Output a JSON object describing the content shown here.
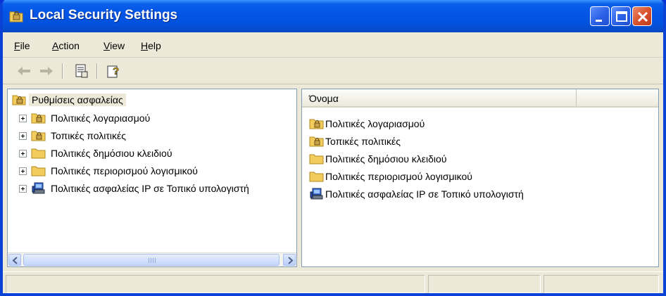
{
  "window": {
    "title": "Local Security Settings"
  },
  "menu": {
    "file": {
      "accel": "F",
      "rest": "ile"
    },
    "action": {
      "accel": "A",
      "rest": "ction"
    },
    "view": {
      "accel": "V",
      "rest": "iew"
    },
    "help": {
      "accel": "H",
      "rest": "elp"
    }
  },
  "tree": {
    "root": "Ρυθμίσεις ασφαλείας",
    "items": [
      {
        "label": "Πολιτικές λογαριασμού",
        "icon": "folder-lock-icon"
      },
      {
        "label": "Τοπικές πολιτικές",
        "icon": "folder-lock-icon"
      },
      {
        "label": "Πολιτικές δημόσιου κλειδιού",
        "icon": "folder-icon"
      },
      {
        "label": "Πολιτικές περιορισμού λογισμικού",
        "icon": "folder-icon"
      },
      {
        "label": "Πολιτικές ασφαλείας IP σε Τοπικό υπολογιστή",
        "icon": "ip-security-icon"
      }
    ]
  },
  "list": {
    "column_name": "Όνομα",
    "items": [
      {
        "label": "Πολιτικές λογαριασμού",
        "icon": "folder-lock-icon"
      },
      {
        "label": "Τοπικές πολιτικές",
        "icon": "folder-lock-icon"
      },
      {
        "label": "Πολιτικές δημόσιου κλειδιού",
        "icon": "folder-icon"
      },
      {
        "label": "Πολιτικές περιορισμού λογισμικού",
        "icon": "folder-icon"
      },
      {
        "label": "Πολιτικές ασφαλείας IP σε Τοπικό υπολογιστή",
        "icon": "ip-security-icon"
      }
    ]
  },
  "colors": {
    "titlebar": "#0355e6",
    "window_bg": "#ece9d8",
    "folder": "#f2cc5c",
    "selection_bg": "#ece9d8"
  }
}
